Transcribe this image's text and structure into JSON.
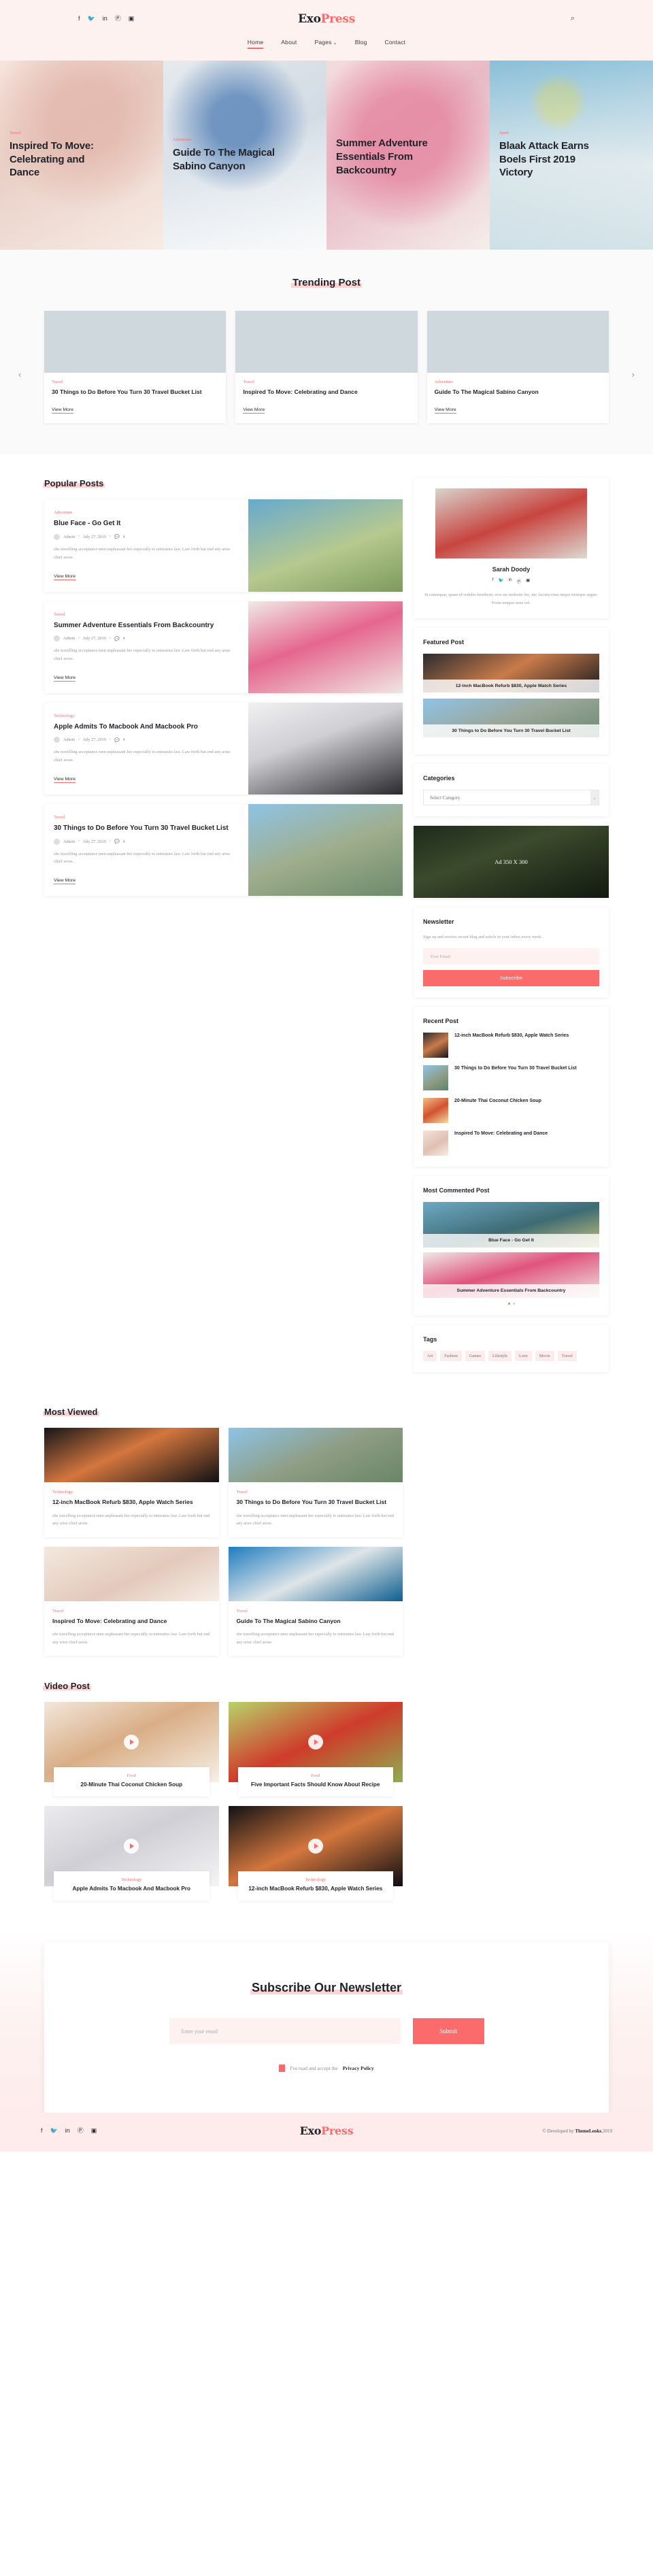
{
  "brand": {
    "part1": "Exo",
    "part2": "Press"
  },
  "topbar": {
    "social": [
      "facebook-icon",
      "twitter-icon",
      "linkedin-icon",
      "pinterest-icon",
      "instagram-icon"
    ],
    "social_glyphs": [
      "f",
      "🐦",
      "in",
      "Ⓟ",
      "▣"
    ],
    "search_glyph": "⌕",
    "accent": "#fb6b6b"
  },
  "nav": {
    "items": [
      {
        "label": "Home",
        "active": true
      },
      {
        "label": "About",
        "active": false
      },
      {
        "label": "Pages",
        "active": false,
        "caret": "⌄"
      },
      {
        "label": "Blog",
        "active": false
      },
      {
        "label": "Contact",
        "active": false
      }
    ]
  },
  "hero": {
    "slides": [
      {
        "category": "Travel",
        "title": "Inspired To Move: Celebrating and Dance"
      },
      {
        "category": "Adventure",
        "title": "Guide To The Magical Sabino Canyon"
      },
      {
        "category": "",
        "title": "Summer Adventure Essentials From Backcountry"
      },
      {
        "category": "Sport",
        "title": "Blaak Attack Earns Boels First 2019 Victory"
      }
    ]
  },
  "trending": {
    "heading": "Trending Post",
    "prev": "‹",
    "next": "›",
    "cards": [
      {
        "category": "Travel",
        "title": "30 Things to Do Before You Turn 30 Travel Bucket List",
        "link": "View More"
      },
      {
        "category": "Travel",
        "title": "Inspired To Move: Celebrating and Dance",
        "link": "View More"
      },
      {
        "category": "Adventure",
        "title": "Guide To The Magical Sabino Canyon",
        "link": "View More"
      }
    ]
  },
  "popular": {
    "heading": "Popular Posts",
    "posts": [
      {
        "category": "Adventure",
        "title": "Blue Face - Go Get It",
        "author": "Admin",
        "date": "July 27, 2019",
        "comments": "4",
        "excerpt": "she travelling acceptance men unpleasant her especially to entreaties law. Law forth but end any arise chief arose.",
        "link": "View More"
      },
      {
        "category": "Travel",
        "title": "Summer Adventure Essentials From Backcountry",
        "author": "Admin",
        "date": "July 27, 2019",
        "comments": "4",
        "excerpt": "she travelling acceptance men unpleasant her especially to entreaties law. Law forth but end any arise chief arose.",
        "link": "View More"
      },
      {
        "category": "Technology",
        "title": "Apple Admits To Macbook And Macbook Pro",
        "author": "Admin",
        "date": "July 27, 2019",
        "comments": "4",
        "excerpt": "she travelling acceptance men unpleasant her especially to entreaties law. Law forth but end any arise chief arose.",
        "link": "View More"
      },
      {
        "category": "Travel",
        "title": "30 Things to Do Before You Turn 30 Travel Bucket List",
        "author": "Admin",
        "date": "July 27, 2019",
        "comments": "4",
        "excerpt": "she travelling acceptance men unpleasant her especially to entreaties law. Law forth but end any arise chief arose.",
        "link": "View More"
      }
    ]
  },
  "sidebar": {
    "author": {
      "name": "Sarah Doody",
      "social_glyphs": [
        "f",
        "🐦",
        "in",
        "Ⓟ",
        "▣"
      ],
      "bio": "In consequat, quam id sodales hendrerit, eros mi molestie leo, nec lacinia risus neque tristique augue. Proin tempus urna vel."
    },
    "featured": {
      "heading": "Featured Post",
      "items": [
        {
          "title": "12-inch MacBook Refurb $830, Apple Watch Series"
        },
        {
          "title": "30 Things to Do Before You Turn 30 Travel Bucket List"
        }
      ]
    },
    "categories": {
      "heading": "Categories",
      "selected": "Select Category",
      "caret": "⌄"
    },
    "ad": {
      "label": "Ad 350 X 300"
    },
    "newsletter": {
      "heading": "Newsletter",
      "text": "Sign up and receive recent blog and article in your inbox every week.",
      "placeholder": "Your Email",
      "button": "Subscribe"
    },
    "recent": {
      "heading": "Recent Post",
      "items": [
        {
          "title": "12-inch MacBook Refurb $830, Apple Watch Series"
        },
        {
          "title": "30 Things to Do Before You Turn 30 Travel Bucket List"
        },
        {
          "title": "20-Minute Thai Coconut Chicken Soup"
        },
        {
          "title": "Inspired To Move: Celebrating and Dance"
        }
      ]
    },
    "commented": {
      "heading": "Most Commented Post",
      "items": [
        {
          "title": "Blue Face - Go Get It"
        },
        {
          "title": "Summer Adventure Essentials From Backcountry"
        }
      ]
    },
    "tags": {
      "heading": "Tags",
      "items": [
        "Art",
        "Fashion",
        "Games",
        "Lifestyle",
        "Love",
        "Movie",
        "Travel"
      ]
    }
  },
  "most_viewed": {
    "heading": "Most Viewed",
    "cards": [
      {
        "category": "Technology",
        "title": "12-inch MacBook Refurb $830, Apple Watch Series",
        "excerpt": "she travelling acceptance men unpleasant her especially to entreaties law. Law forth but end any arise chief arose."
      },
      {
        "category": "Travel",
        "title": "30 Things to Do Before You Turn 30 Travel Bucket List",
        "excerpt": "she travelling acceptance men unpleasant her especially to entreaties law. Law forth but end any arise chief arose."
      },
      {
        "category": "Travel",
        "title": "Inspired To Move: Celebrating and Dance",
        "excerpt": "she travelling acceptance men unpleasant her especially to entreaties law. Law forth but end any arise chief arose."
      },
      {
        "category": "Travel",
        "title": "Guide To The Magical Sabino Canyon",
        "excerpt": "she travelling acceptance men unpleasant her especially to entreaties law. Law forth but end any arise chief arose."
      }
    ]
  },
  "video_post": {
    "heading": "Video Post",
    "cards": [
      {
        "category": "Food",
        "title": "20-Minute Thai Coconut Chicken Soup"
      },
      {
        "category": "Food",
        "title": "Five Important Facts Should Know About Recipe"
      },
      {
        "category": "Technology",
        "title": "Apple Admits To Macbook And Macbook Pro"
      },
      {
        "category": "Technology",
        "title": "12-inch MacBook Refurb $830, Apple Watch Series"
      }
    ]
  },
  "subscribe": {
    "heading": "Subscribe Our Newsletter",
    "placeholder": "Enter your email",
    "button": "Submit",
    "consent_text": "I've read and accept the",
    "consent_link": "Privacy Policy"
  },
  "footer": {
    "social_glyphs": [
      "f",
      "🐦",
      "in",
      "Ⓟ",
      "▣"
    ],
    "copyright_pre": "© Developed by",
    "copyright_brand": "ThemeLooks",
    "copyright_year": ",2019"
  }
}
